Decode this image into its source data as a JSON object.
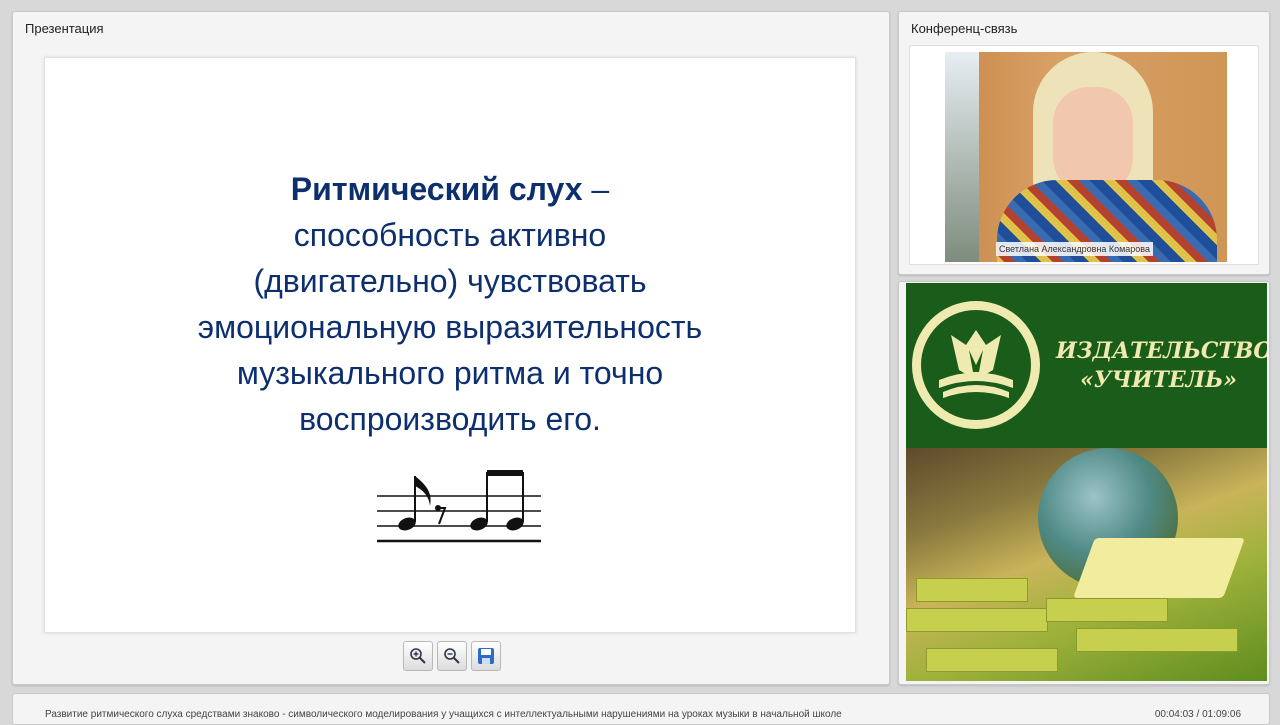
{
  "presentation": {
    "title": "Презентация",
    "slide": {
      "term": "Ритмический слух",
      "dash": " –",
      "lines": [
        "способность  активно",
        "(двигательно) чувствовать",
        "эмоциональную выразительность",
        "музыкального ритма и  точно",
        "воспроизводить его."
      ],
      "text_color": "#0d2f6e"
    },
    "toolbar": {
      "zoom_in_icon": "zoom-in-icon",
      "zoom_out_icon": "zoom-out-icon",
      "save_icon": "save-icon"
    }
  },
  "conference": {
    "title": "Конференц-связь",
    "speaker_name": "Светлана Александровна Комарова"
  },
  "ad": {
    "line1": "ИЗДАТЕЛЬСТВО",
    "line2": "«УЧИТЕЛЬ»",
    "brand_color": "#1a5c19"
  },
  "footer": {
    "course_title": "Развитие ритмического слуха средствами знаково - символического моделирования у учащихся с интеллектуальными нарушениями на уроках музыки в начальной школе",
    "time": "00:04:03 / 01:09:06"
  }
}
